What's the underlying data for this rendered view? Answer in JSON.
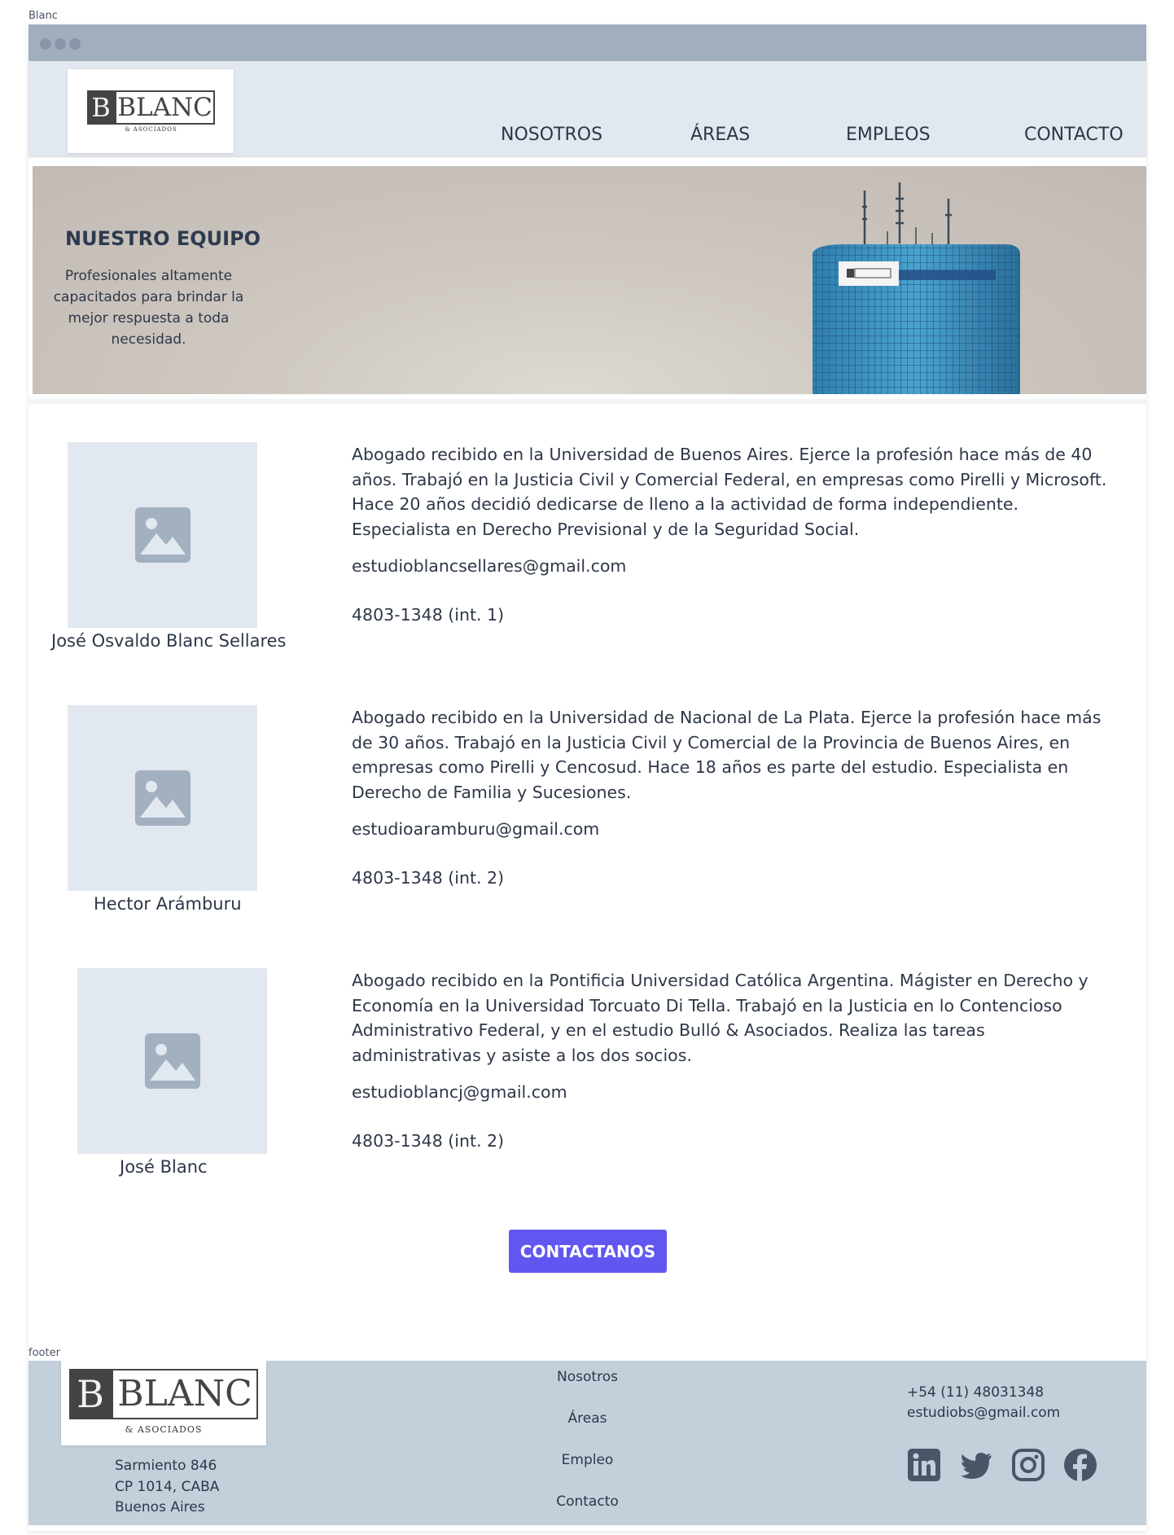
{
  "frame_label": "Blanc",
  "footer_label": "footer",
  "logo": {
    "mark": "B",
    "name": "BLANC",
    "sub": "& ASOCIADOS"
  },
  "nav": [
    "NOSOTROS",
    "ÁREAS",
    "EMPLEOS",
    "CONTACTO"
  ],
  "hero": {
    "title": "NUESTRO EQUIPO",
    "subtitle": "Profesionales altamente capacitados para brindar la mejor respuesta a toda necesidad."
  },
  "members": [
    {
      "name": "José Osvaldo Blanc Sellares",
      "bio": "Abogado recibido en la Universidad de Buenos Aires. Ejerce la profesión hace más de 40 años. Trabajó en la Justicia Civil y Comercial Federal, en empresas como Pirelli y Microsoft. Hace 20 años decidió dedicarse de lleno a la actividad de forma independiente. Especialista en Derecho Previsional y de la Seguridad Social.",
      "email": "estudioblancsellares@gmail.com",
      "phone": "4803-1348 (int. 1)"
    },
    {
      "name": "Hector Arámburu",
      "bio": "Abogado recibido en la Universidad de Nacional de La Plata. Ejerce la profesión hace más de 30 años. Trabajó en la Justicia Civil y Comercial de la Provincia de Buenos Aires, en empresas como Pirelli y Cencosud. Hace 18 años es parte del estudio. Especialista en Derecho de Familia y Sucesiones.",
      "email": "estudioaramburu@gmail.com",
      "phone": "4803-1348 (int. 2)"
    },
    {
      "name": "José Blanc",
      "bio": "Abogado recibido en la Pontificia Universidad Católica Argentina. Mágister en Derecho y Economía en la Universidad Torcuato Di Tella. Trabajó en la Justicia en lo Contencioso Administrativo Federal, y en el estudio Bulló & Asociados. Realiza las tareas administrativas y asiste a los dos socios.",
      "email": "estudioblancj@gmail.com",
      "phone": "4803-1348 (int. 2)"
    }
  ],
  "cta_label": "CONTACTANOS",
  "footer": {
    "address": [
      "Sarmiento 846",
      "CP 1014, CABA",
      "Buenos Aires"
    ],
    "links": [
      "Nosotros",
      "Áreas",
      "Empleo",
      "Contacto"
    ],
    "phone": "+54 (11) 48031348",
    "email": "estudiobs@gmail.com",
    "social": [
      "linkedin-icon",
      "twitter-icon",
      "instagram-icon",
      "facebook-icon"
    ]
  },
  "colors": {
    "titlebar": "#a0aebe",
    "navbar": "#e2e8f0",
    "accent": "#6157f0",
    "footer": "#c3cfda",
    "text": "#2d3748"
  }
}
